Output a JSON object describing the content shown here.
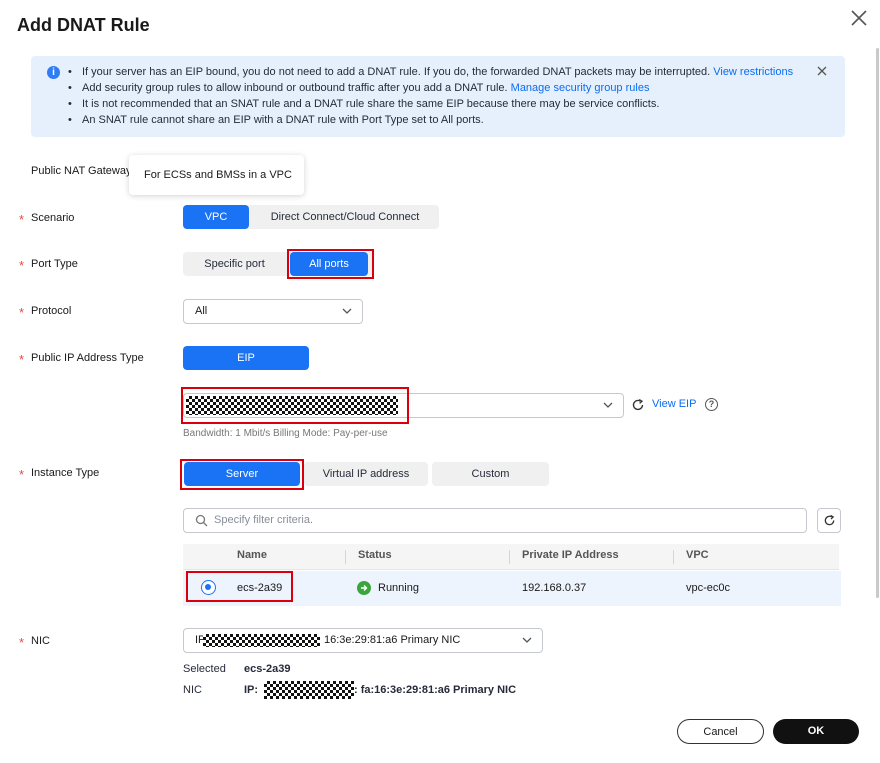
{
  "dialog": {
    "title": "Add DNAT Rule"
  },
  "alert": {
    "lines": [
      {
        "text": "If your server has an EIP bound, you do not need to add a DNAT rule. If you do, the forwarded DNAT packets may be interrupted.",
        "link": "View restrictions"
      },
      {
        "text": "Add security group rules to allow inbound or outbound traffic after you add a DNAT rule.",
        "link": "Manage security group rules"
      },
      {
        "text": "It is not recommended that an SNAT rule and a DNAT rule share the same EIP because there may be service conflicts.",
        "link": ""
      },
      {
        "text": "An SNAT rule cannot share an EIP with a DNAT rule with Port Type set to All ports.",
        "link": ""
      }
    ]
  },
  "form": {
    "gateway_label": "Public NAT Gateway",
    "tooltip": "For ECSs and BMSs in a VPC",
    "scenario": {
      "label": "Scenario",
      "options": [
        "VPC",
        "Direct Connect/Cloud Connect"
      ],
      "selected": "VPC"
    },
    "port_type": {
      "label": "Port Type",
      "options": [
        "Specific port",
        "All ports"
      ],
      "selected": "All ports"
    },
    "protocol": {
      "label": "Protocol",
      "value": "All"
    },
    "public_ip_type": {
      "label": "Public IP Address Type",
      "option": "EIP"
    },
    "eip": {
      "view_label": "View EIP",
      "bandwidth_text": "Bandwidth: 1 Mbit/s Billing Mode: Pay-per-use"
    },
    "instance_type": {
      "label": "Instance Type",
      "options": [
        "Server",
        "Virtual IP address",
        "Custom"
      ],
      "selected": "Server"
    },
    "search": {
      "placeholder": "Specify filter criteria."
    },
    "table": {
      "columns": [
        "Name",
        "Status",
        "Private IP Address",
        "VPC"
      ],
      "rows": [
        {
          "name": "ecs-2a39",
          "status": "Running",
          "ip": "192.168.0.37",
          "vpc": "vpc-ec0c"
        }
      ]
    },
    "nic": {
      "label": "NIC",
      "select_prefix": "IP",
      "select_suffix": "16:3e:29:81:a6 Primary NIC",
      "selected_label": "Selected",
      "selected_value": "ecs-2a39",
      "nic_label": "NIC",
      "ip_prefix": "IP: ",
      "ip_suffix": ": fa:16:3e:29:81:a6 Primary NIC"
    }
  },
  "footer": {
    "cancel": "Cancel",
    "ok": "OK"
  },
  "colors": {
    "primary": "#1a73f5",
    "highlight": "#d9000b",
    "running": "#3aa63c"
  }
}
